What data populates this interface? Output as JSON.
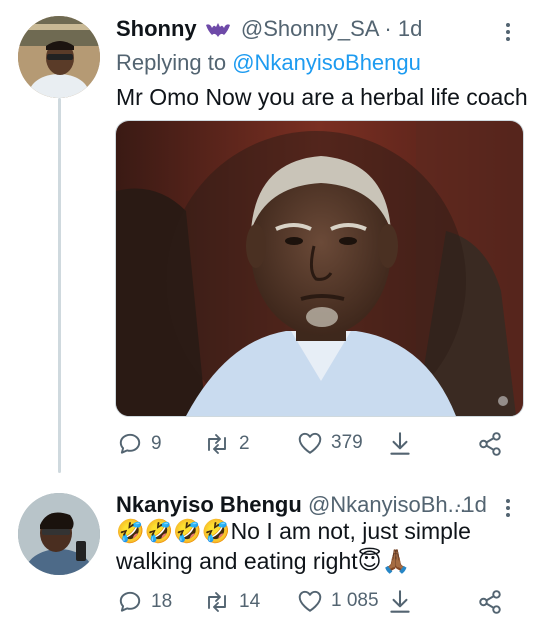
{
  "tweets": [
    {
      "display_name": "Shonny",
      "badge_icon": "bat-emoji-icon",
      "handle": "@Shonny_SA",
      "separator": "·",
      "time": "1d",
      "replying_prefix": "Replying to",
      "replying_to": "@NkanyisoBhengu",
      "text": "Mr Omo Now you are a herbal life coach",
      "media_alt": "photo of an elderly man seated in a leather chair",
      "actions": {
        "replies": "9",
        "retweets": "2",
        "likes": "379"
      }
    },
    {
      "display_name": "Nkanyiso Bhengu",
      "handle": "@NkanyisoBh...",
      "separator": "·",
      "time": "1d",
      "emoji_prefix": "🤣🤣🤣🤣",
      "text_line1": "No I am not, just simple",
      "text_line2": "walking and eating right",
      "emoji_suffix": "😇🙏🏾",
      "actions": {
        "replies": "18",
        "retweets": "14",
        "likes": "1 085"
      }
    }
  ],
  "colors": {
    "link": "#1d9bf0",
    "muted": "#536471",
    "text": "#0f1419",
    "line": "#cfd9de"
  }
}
